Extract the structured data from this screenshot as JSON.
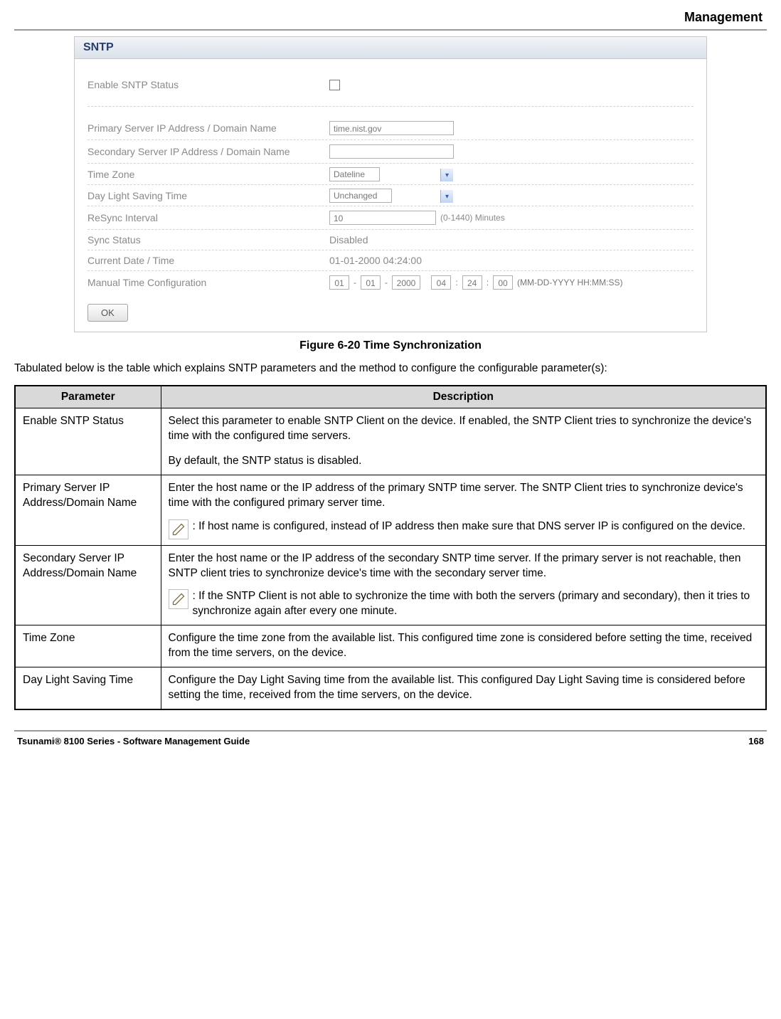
{
  "header": {
    "title": "Management"
  },
  "panel": {
    "title": "SNTP",
    "rows": {
      "enable": {
        "label": "Enable SNTP Status"
      },
      "primary": {
        "label": "Primary Server IP Address / Domain Name",
        "value": "time.nist.gov"
      },
      "secondary": {
        "label": "Secondary Server IP Address / Domain Name",
        "value": ""
      },
      "timezone": {
        "label": "Time Zone",
        "value": "Dateline"
      },
      "dst": {
        "label": "Day Light Saving Time",
        "value": "Unchanged"
      },
      "resync": {
        "label": "ReSync Interval",
        "value": "10",
        "hint": "(0-1440) Minutes"
      },
      "sync": {
        "label": "Sync Status",
        "value": "Disabled"
      },
      "current": {
        "label": "Current Date / Time",
        "value": "01-01-2000 04:24:00"
      },
      "manual": {
        "label": "Manual Time Configuration",
        "mm": "01",
        "dd": "01",
        "yyyy": "2000",
        "hh": "04",
        "mi": "24",
        "ss": "00",
        "fmt": "(MM-DD-YYYY HH:MM:SS)"
      }
    },
    "ok": "OK"
  },
  "figure": {
    "caption": "Figure 6-20 Time Synchronization"
  },
  "intro": "Tabulated below is the table which explains SNTP parameters and the method to configure the configurable parameter(s):",
  "table": {
    "headers": {
      "param": "Parameter",
      "desc": "Description"
    },
    "rows": [
      {
        "param": "Enable SNTP Status",
        "desc1": "Select this parameter to enable SNTP Client on the device. If enabled, the SNTP Client tries to synchronize the device's time with the configured time servers.",
        "desc2": "By default, the SNTP status is disabled."
      },
      {
        "param": "Primary Server IP Address/Domain Name",
        "desc1": "Enter the host name or the IP address of the primary SNTP time server. The SNTP Client tries to synchronize device's time with the configured primary server time.",
        "note": ": If host name is configured, instead of IP address then make sure that DNS server IP is configured on the device."
      },
      {
        "param": "Secondary Server IP Address/Domain Name",
        "desc1": "Enter the host name or the IP address of the secondary SNTP time server. If the primary server is not reachable, then SNTP client tries to synchronize device's time with the secondary server time.",
        "note": ": If the SNTP Client is not able to sychronize the time with both the servers (primary and secondary), then it tries to synchronize again after every one minute."
      },
      {
        "param": "Time Zone",
        "desc1": "Configure the time zone from the available list. This configured time zone is considered before setting the time, received from the time servers, on the device."
      },
      {
        "param": "Day Light Saving Time",
        "desc1": "Configure the Day Light Saving time from the available list. This configured Day Light Saving time is considered before setting the time, received from the time servers, on the device."
      }
    ]
  },
  "footer": {
    "left": "Tsunami® 8100 Series - Software Management Guide",
    "right": "168"
  }
}
